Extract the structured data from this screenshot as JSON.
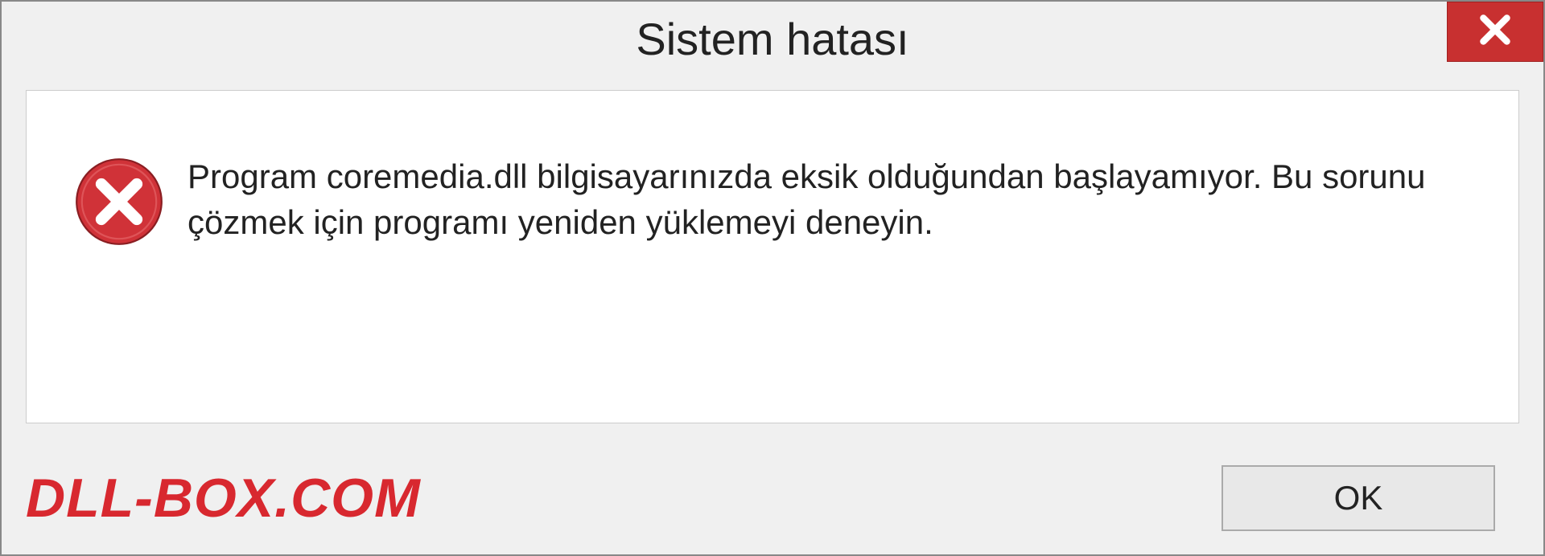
{
  "dialog": {
    "title": "Sistem hatası",
    "message": "Program coremedia.dll bilgisayarınızda eksik olduğundan başlayamıyor. Bu sorunu çözmek için programı yeniden yüklemeyi deneyin.",
    "ok_label": "OK"
  },
  "watermark": "DLL-BOX.COM",
  "colors": {
    "close_bg": "#c83030",
    "error_icon": "#d03238",
    "watermark": "#d8282f"
  }
}
